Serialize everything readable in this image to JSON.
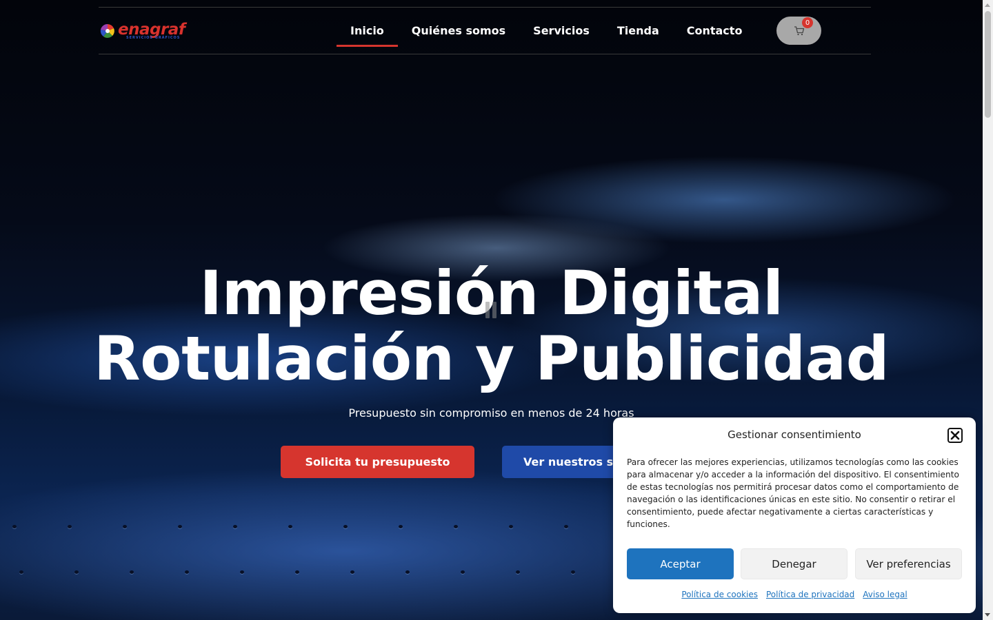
{
  "brand": {
    "name": "enagraf",
    "tagline": "SERVICIOS GRÁFICOS",
    "colors": {
      "red": "#d6352e",
      "blue": "#1f4aa8",
      "accept_blue": "#1e73be"
    }
  },
  "nav": {
    "items": [
      {
        "label": "Inicio",
        "active": true
      },
      {
        "label": "Quiénes somos",
        "active": false
      },
      {
        "label": "Servicios",
        "active": false
      },
      {
        "label": "Tienda",
        "active": false
      },
      {
        "label": "Contacto",
        "active": false
      }
    ],
    "cart": {
      "icon": "cart-icon",
      "count": "0"
    }
  },
  "hero": {
    "title_line1": "Impresión Digital",
    "title_line2": "Rotulación y Publicidad",
    "subtitle": "Presupuesto sin compromiso en menos de 24 horas",
    "primary_button": "Solicita tu presupuesto",
    "secondary_button": "Ver nuestros servicios",
    "video_control_icon": "pause-icon"
  },
  "consent": {
    "title": "Gestionar consentimiento",
    "close_icon": "close-icon",
    "body": "Para ofrecer las mejores experiencias, utilizamos tecnologías como las cookies para almacenar y/o acceder a la información del dispositivo. El consentimiento de estas tecnologías nos permitirá procesar datos como el comportamiento de navegación o las identificaciones únicas en este sitio. No consentir o retirar el consentimiento, puede afectar negativamente a ciertas características y funciones.",
    "accept": "Aceptar",
    "deny": "Denegar",
    "preferences": "Ver preferencias",
    "links": [
      "Política de cookies",
      "Política de privacidad",
      "Aviso legal"
    ]
  }
}
